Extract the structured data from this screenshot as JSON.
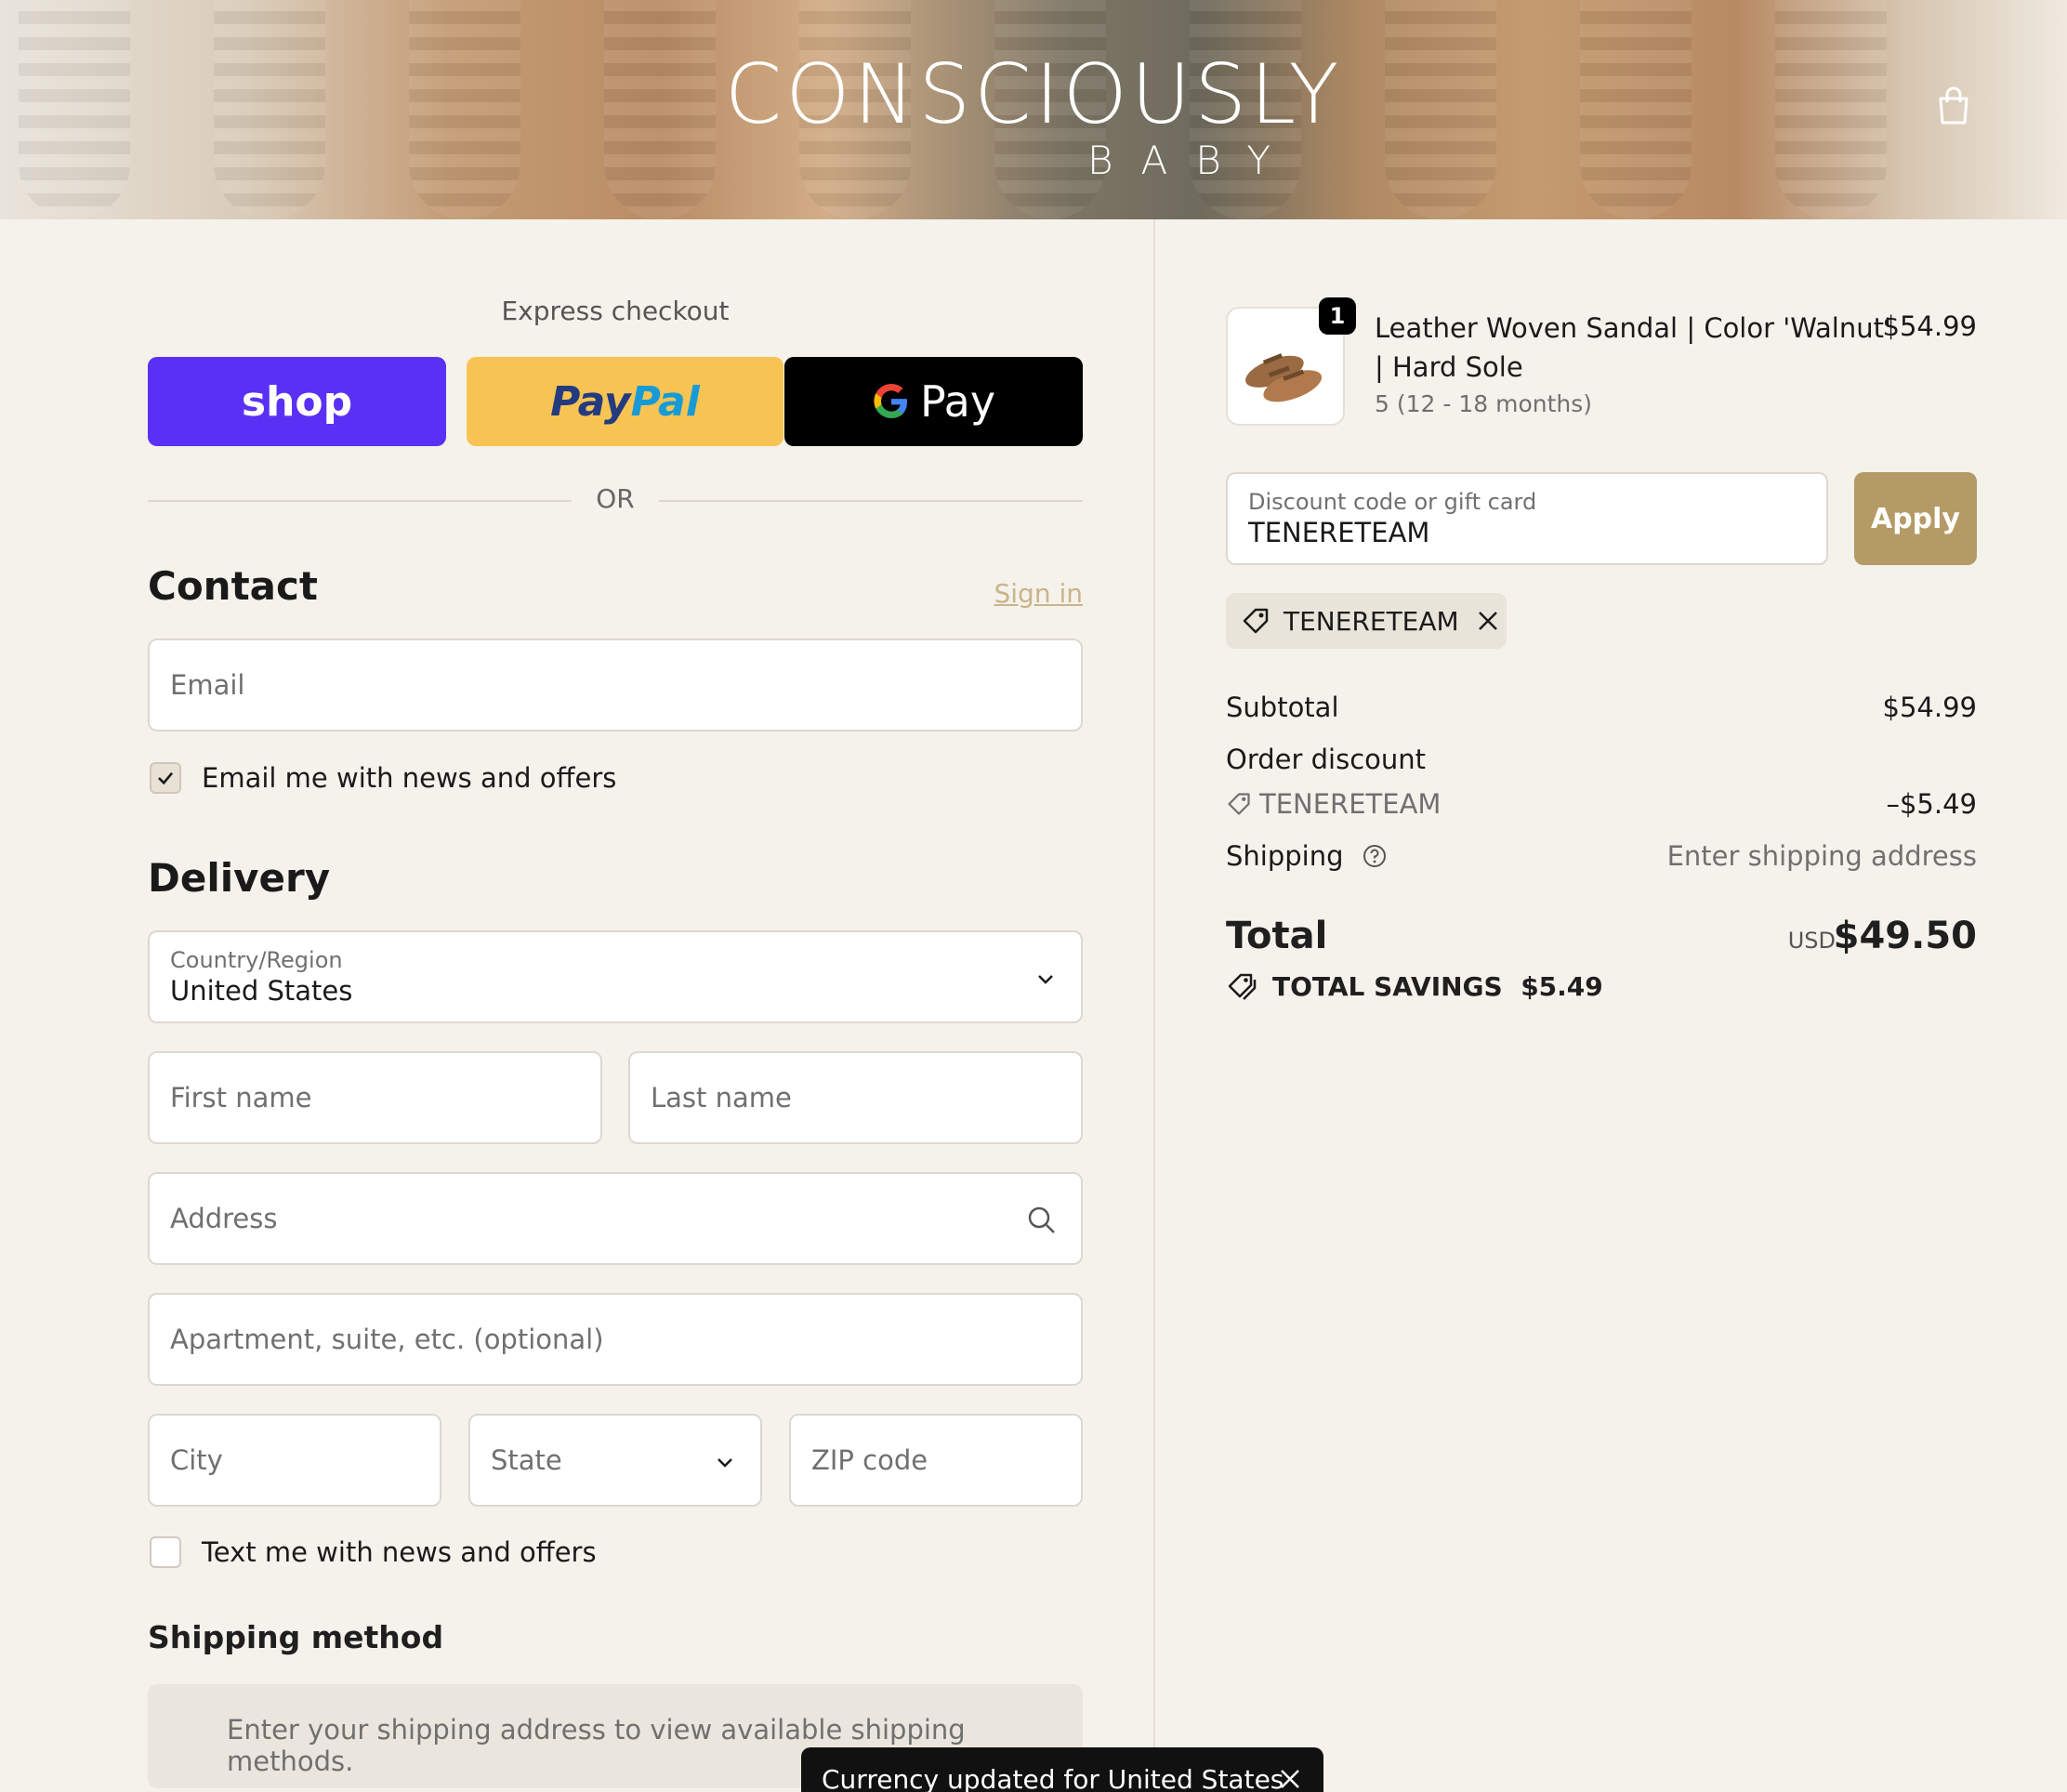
{
  "brand": {
    "logo_main": "CONSCIOUSLY",
    "logo_sub": "BABY"
  },
  "express": {
    "title": "Express checkout",
    "shop_label": "shop",
    "paypal_part1": "Pay",
    "paypal_part2": "Pal",
    "gpay_label": "Pay",
    "or_label": "OR"
  },
  "contact": {
    "title": "Contact",
    "signin_label": "Sign in",
    "email_placeholder": "Email",
    "email_opt_in_label": "Email me with news and offers",
    "email_opt_in_checked": true
  },
  "delivery": {
    "title": "Delivery",
    "country_label": "Country/Region",
    "country_value": "United States",
    "first_name_placeholder": "First name",
    "last_name_placeholder": "Last name",
    "address_placeholder": "Address",
    "apartment_placeholder": "Apartment, suite, etc. (optional)",
    "city_placeholder": "City",
    "state_placeholder": "State",
    "zip_placeholder": "ZIP code",
    "text_opt_in_label": "Text me with news and offers",
    "text_opt_in_checked": false
  },
  "shipping_method": {
    "title": "Shipping method",
    "message": "Enter your shipping address to view available shipping methods."
  },
  "cart": {
    "item": {
      "quantity": "1",
      "name": "Leather Woven Sandal | Color 'Walnut' | Hard Sole",
      "variant": "5 (12 - 18 months)",
      "price": "$54.99"
    },
    "discount_label": "Discount code or gift card",
    "discount_value": "TENERETEAM",
    "apply_label": "Apply",
    "applied_code": "TENERETEAM"
  },
  "summary": {
    "subtotal_label": "Subtotal",
    "subtotal_value": "$54.99",
    "order_discount_label": "Order discount",
    "discount_code": "TENERETEAM",
    "discount_value": "–$5.49",
    "shipping_label": "Shipping",
    "shipping_value": "Enter shipping address",
    "total_label": "Total",
    "currency": "USD",
    "total_value": "$49.50",
    "savings_label": "TOTAL SAVINGS",
    "savings_value": "$5.49"
  },
  "toast": {
    "message": "Currency updated for United States"
  },
  "colors": {
    "shop": "#5a31f4",
    "paypal": "#f7c453",
    "apply": "#b49a65",
    "background": "#f5f2ec"
  }
}
